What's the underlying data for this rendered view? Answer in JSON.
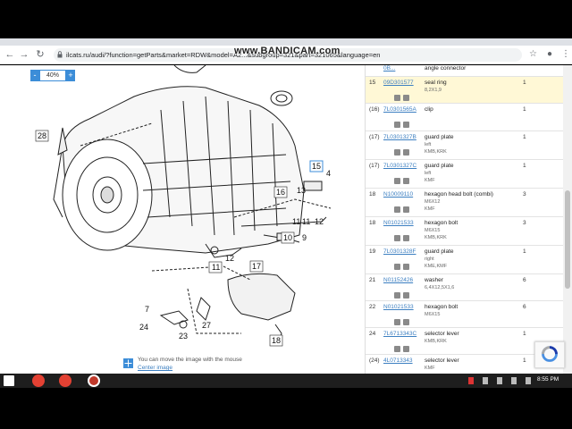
{
  "browser": {
    "url": "ilcats.ru/audi/?function=getParts&market=RDW&model=A2...&subgroup=321&part=321065&language=en",
    "watermark": "www.BANDICAM.com"
  },
  "viewer": {
    "zoom_minus": "-",
    "zoom_value": "40%",
    "zoom_plus": "+",
    "hint_text": "You can move the image with the mouse",
    "hint_link": "Center image"
  },
  "callouts": [
    "28",
    "15",
    "4",
    "13",
    "16",
    "11",
    "11",
    "12",
    "9",
    "10",
    "11",
    "12",
    "17",
    "7",
    "24",
    "23",
    "27",
    "18"
  ],
  "parts": [
    {
      "num": "",
      "code": "0B...",
      "name": "angle connector",
      "d1": "",
      "d2": "",
      "qty": ""
    },
    {
      "num": "15",
      "code": "09D301577",
      "name": "seal ring",
      "d1": "8,2X1,9",
      "d2": "",
      "qty": "1"
    },
    {
      "num": "(16)",
      "code": "7L0301565A",
      "name": "clip",
      "d1": "",
      "d2": "",
      "qty": "1"
    },
    {
      "num": "(17)",
      "code": "7L0301327B",
      "name": "guard plate",
      "d1": "left",
      "d2": "KMB,KRK",
      "qty": "1"
    },
    {
      "num": "(17)",
      "code": "7L0301327C",
      "name": "guard plate",
      "d1": "left",
      "d2": "KMF",
      "qty": "1"
    },
    {
      "num": "18",
      "code": "N10009110",
      "name": "hexagon head bolt (combi)",
      "d1": "M6X12",
      "d2": "KMF",
      "qty": "3"
    },
    {
      "num": "18",
      "code": "N01021533",
      "name": "hexagon bolt",
      "d1": "M6X15",
      "d2": "KMB,KRK",
      "qty": "3"
    },
    {
      "num": "19",
      "code": "7L0301328F",
      "name": "guard plate",
      "d1": "right",
      "d2": "KME,KMF",
      "qty": "1"
    },
    {
      "num": "21",
      "code": "N01152426",
      "name": "washer",
      "d1": "6,4X12,5X1,6",
      "d2": "",
      "qty": "6"
    },
    {
      "num": "22",
      "code": "N01021533",
      "name": "hexagon bolt",
      "d1": "M6X15",
      "d2": "",
      "qty": "6"
    },
    {
      "num": "24",
      "code": "7L6713343C",
      "name": "selector lever",
      "d1": "KMB,KRK",
      "d2": "",
      "qty": "1"
    },
    {
      "num": "(24)",
      "code": "4L0713343",
      "name": "selector lever",
      "d1": "KMF",
      "d2": "",
      "qty": "1"
    }
  ],
  "taskbar": {
    "time": "8:55 PM"
  },
  "colors": {
    "accent": "#3c8dd8",
    "highlight": "#fff8d6",
    "link": "#3c7fc1"
  }
}
